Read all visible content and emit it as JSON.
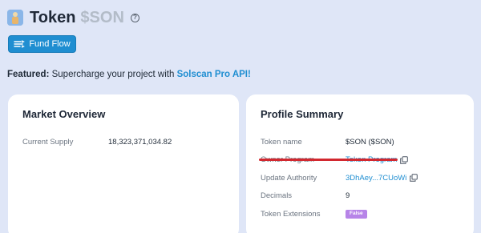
{
  "header": {
    "token_label": "Token",
    "token_symbol": "$SON",
    "help_glyph": "?"
  },
  "actions": {
    "fund_flow_label": "Fund Flow"
  },
  "featured": {
    "prefix": "Featured:",
    "text": " Supercharge your project with ",
    "link": "Solscan Pro API!"
  },
  "market_overview": {
    "title": "Market Overview",
    "rows": [
      {
        "label": "Current Supply",
        "value": "18,323,371,034.82"
      }
    ]
  },
  "profile_summary": {
    "title": "Profile Summary",
    "rows": [
      {
        "label": "Token name",
        "value": "$SON ($SON)"
      },
      {
        "label": "Owner Program",
        "value": "Token Program"
      },
      {
        "label": "Update Authority",
        "value": "3DhAey...7CUoWi"
      },
      {
        "label": "Decimals",
        "value": "9"
      },
      {
        "label": "Token Extensions",
        "value": "False"
      }
    ]
  },
  "colors": {
    "accent": "#1f8ed1",
    "badge": "#b784e8",
    "highlight_underline": "#d2282f",
    "background": "#dfe6f7"
  },
  "icons": [
    "token-logo-icon",
    "help-icon",
    "fund-flow-icon",
    "copy-icon"
  ]
}
